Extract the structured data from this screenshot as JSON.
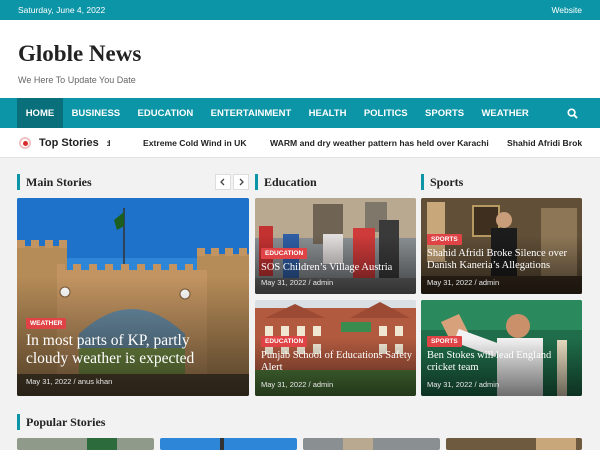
{
  "topbar": {
    "date": "Saturday, June 4, 2022",
    "link": "Website"
  },
  "brand": {
    "title": "Globle News",
    "tagline": "We Here To Update You Date"
  },
  "nav": {
    "items": [
      "HOME",
      "BUSINESS",
      "EDUCATION",
      "ENTERTAINMENT",
      "HEALTH",
      "POLITICS",
      "SPORTS",
      "WEATHER"
    ],
    "active": "HOME",
    "search_icon": "search-icon"
  },
  "ticker": {
    "label": "Top Stories",
    "items": [
      "nd",
      "Extreme Cold Wind in UK",
      "WARM and dry weather pattern has held over Karachi",
      "Shahid Afridi Brok"
    ]
  },
  "sections": {
    "main": "Main Stories",
    "education": "Education",
    "sports": "Sports",
    "popular": "Popular Stories"
  },
  "main_story": {
    "category": "WEATHER",
    "title": "In most parts of KP, partly cloudy weather is expected",
    "date": "May 31, 2022",
    "author": "anus khan",
    "meta": "May 31, 2022 / anus khan"
  },
  "education": [
    {
      "category": "EDUCATION",
      "title": "SOS Children’s Village Austria",
      "meta": "May 31, 2022 / admin"
    },
    {
      "category": "EDUCATION",
      "title": "Punjab School of Educations Safety Alert",
      "meta": "May 31, 2022 / admin"
    }
  ],
  "sports": [
    {
      "category": "SPORTS",
      "title": "Shahid Afridi Broke Silence over Danish Kaneria’s Allegations",
      "meta": "May 31, 2022 / admin"
    },
    {
      "category": "SPORTS",
      "title": "Ben Stokes will lead England cricket team",
      "meta": "May 31, 2022 / admin"
    }
  ],
  "colors": {
    "accent": "#0c95a6",
    "nav_active": "#086f7b",
    "badge": "#e04345"
  }
}
